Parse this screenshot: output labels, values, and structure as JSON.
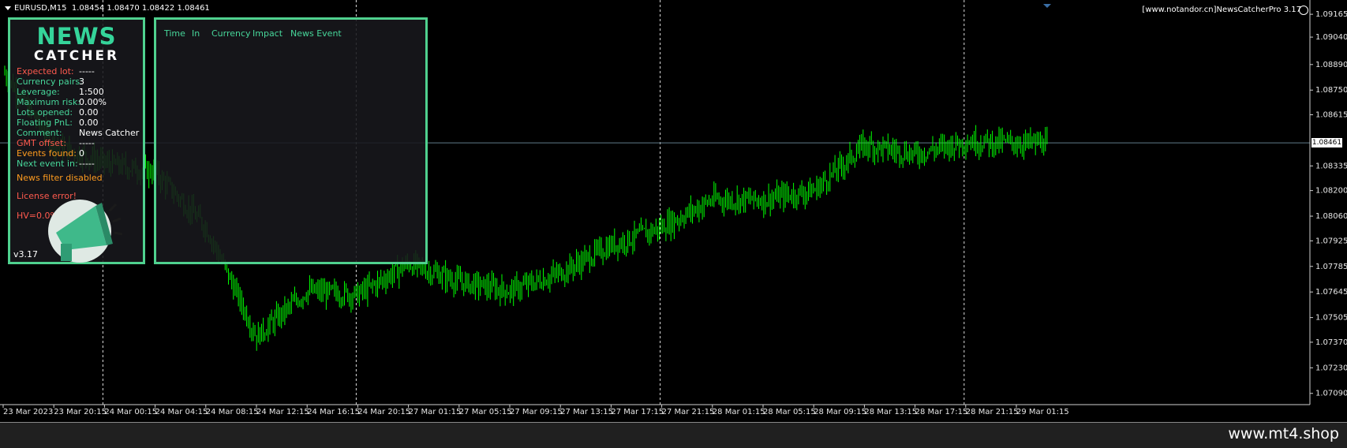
{
  "symbol": {
    "title": "EURUSD,M15",
    "ohlc": "1.08454 1.08470 1.08422 1.08461"
  },
  "ea_label": "[www.notandor.cn]NewsCatcherPro 3.17",
  "price_axis": {
    "labels": [
      "1.09165",
      "1.09040",
      "1.08890",
      "1.08750",
      "1.08615",
      "1.08335",
      "1.08200",
      "1.08060",
      "1.07925",
      "1.07785",
      "1.07645",
      "1.07505",
      "1.07370",
      "1.07230",
      "1.07090"
    ],
    "current": "1.08461"
  },
  "time_axis": {
    "labels": [
      "23 Mar 2023",
      "23 Mar 20:15",
      "24 Mar 00:15",
      "24 Mar 04:15",
      "24 Mar 08:15",
      "24 Mar 12:15",
      "24 Mar 16:15",
      "24 Mar 20:15",
      "27 Mar 01:15",
      "27 Mar 05:15",
      "27 Mar 09:15",
      "27 Mar 13:15",
      "27 Mar 17:15",
      "27 Mar 21:15",
      "28 Mar 01:15",
      "28 Mar 05:15",
      "28 Mar 09:15",
      "28 Mar 13:15",
      "28 Mar 17:15",
      "28 Mar 21:15",
      "29 Mar 01:15"
    ]
  },
  "chart_data": {
    "type": "line",
    "ylim": [
      1.0705,
      1.092
    ],
    "x": [
      "23 Mar 2023",
      "23 Mar 20:15",
      "24 Mar 00:15",
      "24 Mar 04:15",
      "24 Mar 08:15",
      "24 Mar 12:15",
      "24 Mar 16:15",
      "24 Mar 20:15",
      "27 Mar 01:15",
      "27 Mar 05:15",
      "27 Mar 09:15",
      "27 Mar 13:15",
      "27 Mar 17:15",
      "27 Mar 21:15",
      "28 Mar 01:15",
      "28 Mar 05:15",
      "28 Mar 09:15",
      "28 Mar 13:15",
      "28 Mar 17:15",
      "28 Mar 21:15",
      "29 Mar 01:15"
    ],
    "series": [
      {
        "values": [
          1.0885,
          1.0845,
          1.0835,
          1.083,
          1.08,
          1.074,
          1.0765,
          1.0763,
          1.078,
          1.077,
          1.0765,
          1.0775,
          1.079,
          1.08,
          1.0815,
          1.0815,
          1.082,
          1.0845,
          1.084,
          1.0847,
          1.0846
        ]
      }
    ],
    "current_price": 1.08461,
    "grid": "vertical-dashed"
  },
  "info_panel": {
    "logo_top": "NEWS",
    "logo_bottom": "CATCHER",
    "rows": [
      {
        "label": "Expected lot:",
        "value": "-----"
      },
      {
        "label": "Currency pairs:",
        "value": "3"
      },
      {
        "label": "Leverage:",
        "value": "1:500"
      },
      {
        "label": "Maximum risk:",
        "value": "0.00%"
      },
      {
        "label": "Lots opened:",
        "value": "0.00"
      },
      {
        "label": "Floating PnL:",
        "value": "0.00"
      },
      {
        "label": "Comment:",
        "value": "News Catcher"
      },
      {
        "label": "GMT offset:",
        "value": "-----"
      },
      {
        "label": "Events found:",
        "value": "0"
      },
      {
        "label": "Next event in:",
        "value": "-----"
      }
    ],
    "news_filter": "News filter disabled",
    "license": "License error!",
    "hv": "HV=0.0%",
    "version": "v3.17",
    "colors": {
      "red": "#ff5a4e",
      "green": "#47d69a",
      "orange": "#ff9c1f",
      "border": "#4fd18e"
    }
  },
  "news_panel": {
    "headers": [
      "Time",
      "In",
      "Currency",
      "Impact",
      "News Event"
    ]
  },
  "watermark": "www.mt4.shop"
}
